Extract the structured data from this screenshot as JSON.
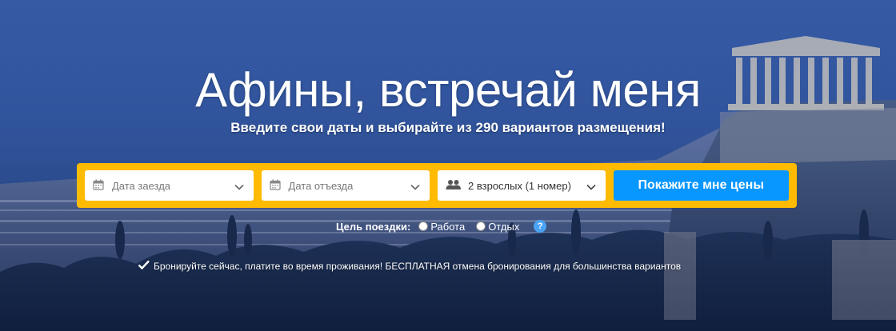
{
  "hero": {
    "city": "Афины",
    "title_rest": ", встречай меня",
    "subtitle": "Введите свои даты и выбирайте из 290 вариантов размещения!"
  },
  "search": {
    "checkin_placeholder": "Дата заезда",
    "checkout_placeholder": "Дата отъезда",
    "guests_value": "2 взрослых (1 номер)",
    "submit_label": "Покажите мне цены",
    "icons": [
      "calendar-icon",
      "calendar-icon",
      "people-icon",
      "chevron-down-icon"
    ]
  },
  "purpose": {
    "label": "Цель поездки:",
    "options": [
      "Работа",
      "Отдых"
    ],
    "help": "?"
  },
  "promo": {
    "text": "Бронируйте сейчас, платите во время проживания! БЕСПЛАТНАЯ отмена бронирования для большинства вариантов",
    "icon": "checkmark-icon"
  },
  "colors": {
    "search_bar_bg": "#febb02",
    "cta_bg": "#0896ff",
    "hero_tint": "#2f54a0"
  }
}
